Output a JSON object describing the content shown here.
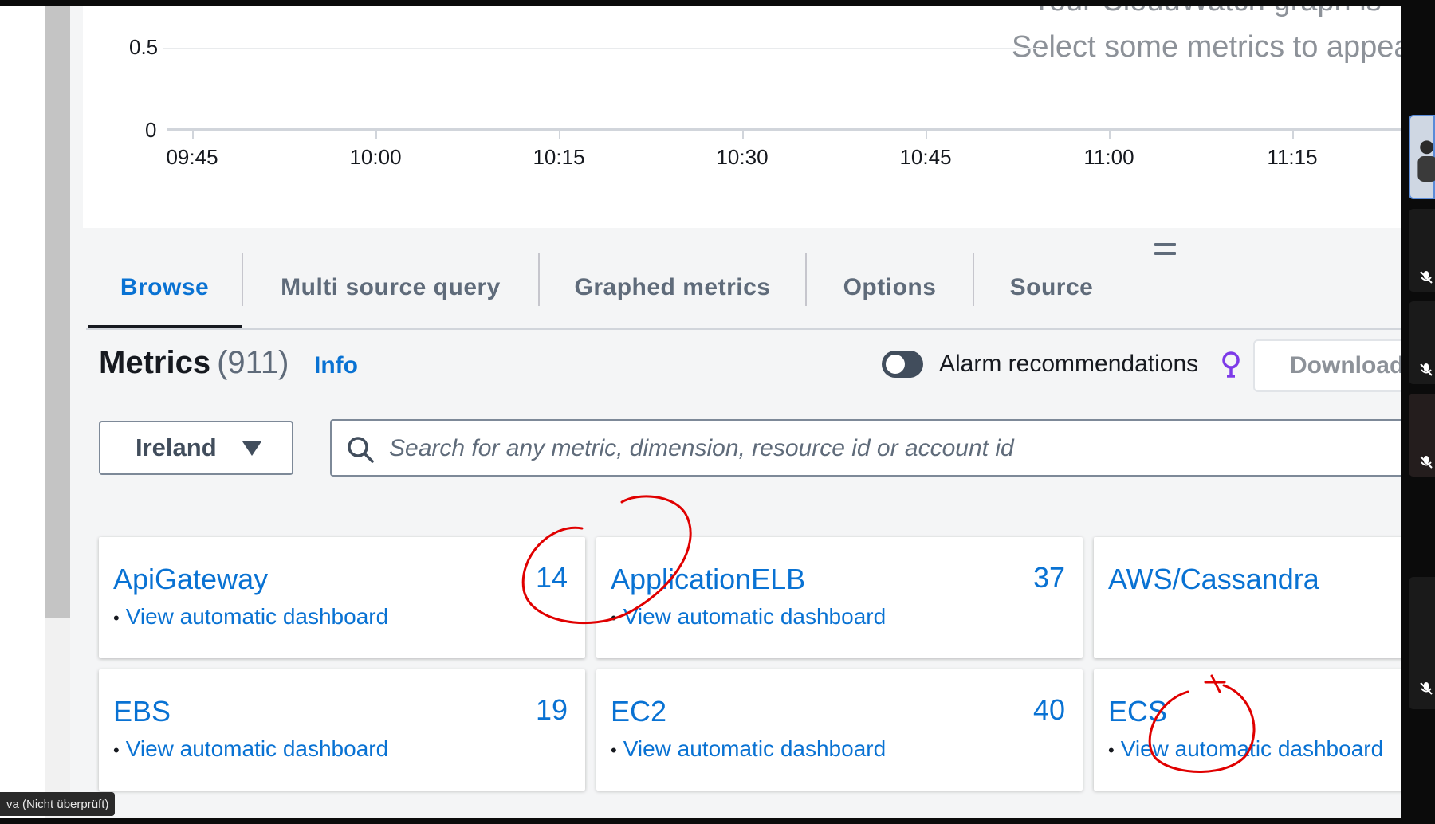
{
  "graph": {
    "y_ticks": [
      "0.5",
      "0"
    ],
    "x_ticks": [
      "09:45",
      "10:00",
      "10:15",
      "10:30",
      "10:45",
      "11:00",
      "11:15"
    ],
    "empty_message_top": "Your CloudWatch graph is",
    "empty_message": "Select some metrics to appear"
  },
  "tabs": [
    {
      "label": "Browse",
      "active": true
    },
    {
      "label": "Multi source query",
      "active": false
    },
    {
      "label": "Graphed metrics",
      "active": false
    },
    {
      "label": "Options",
      "active": false
    },
    {
      "label": "Source",
      "active": false
    }
  ],
  "metrics": {
    "title": "Metrics",
    "count": "(911)",
    "info": "Info",
    "alarm_recommendations": "Alarm recommendations",
    "alarm_toggle_on": false,
    "download": "Download"
  },
  "region": {
    "selected": "Ireland"
  },
  "search": {
    "placeholder": "Search for any metric, dimension, resource id or account id"
  },
  "namespaces": [
    {
      "name": "ApiGateway",
      "count": "14",
      "link": "View automatic dashboard"
    },
    {
      "name": "ApplicationELB",
      "count": "37",
      "link": "View automatic dashboard"
    },
    {
      "name": "AWS/Cassandra",
      "count": "",
      "link": ""
    },
    {
      "name": "EBS",
      "count": "19",
      "link": "View automatic dashboard"
    },
    {
      "name": "EC2",
      "count": "40",
      "link": "View automatic dashboard"
    },
    {
      "name": "ECS",
      "count": "",
      "link": "View automatic dashboard"
    }
  ],
  "overlay": {
    "name_tag": "va (Nicht überprüft)",
    "annotation_color": "#e00000"
  },
  "colors": {
    "link": "#0972d3",
    "text": "#16191f",
    "muted": "#5f6b7a",
    "panel_bg": "#f4f5f6"
  }
}
